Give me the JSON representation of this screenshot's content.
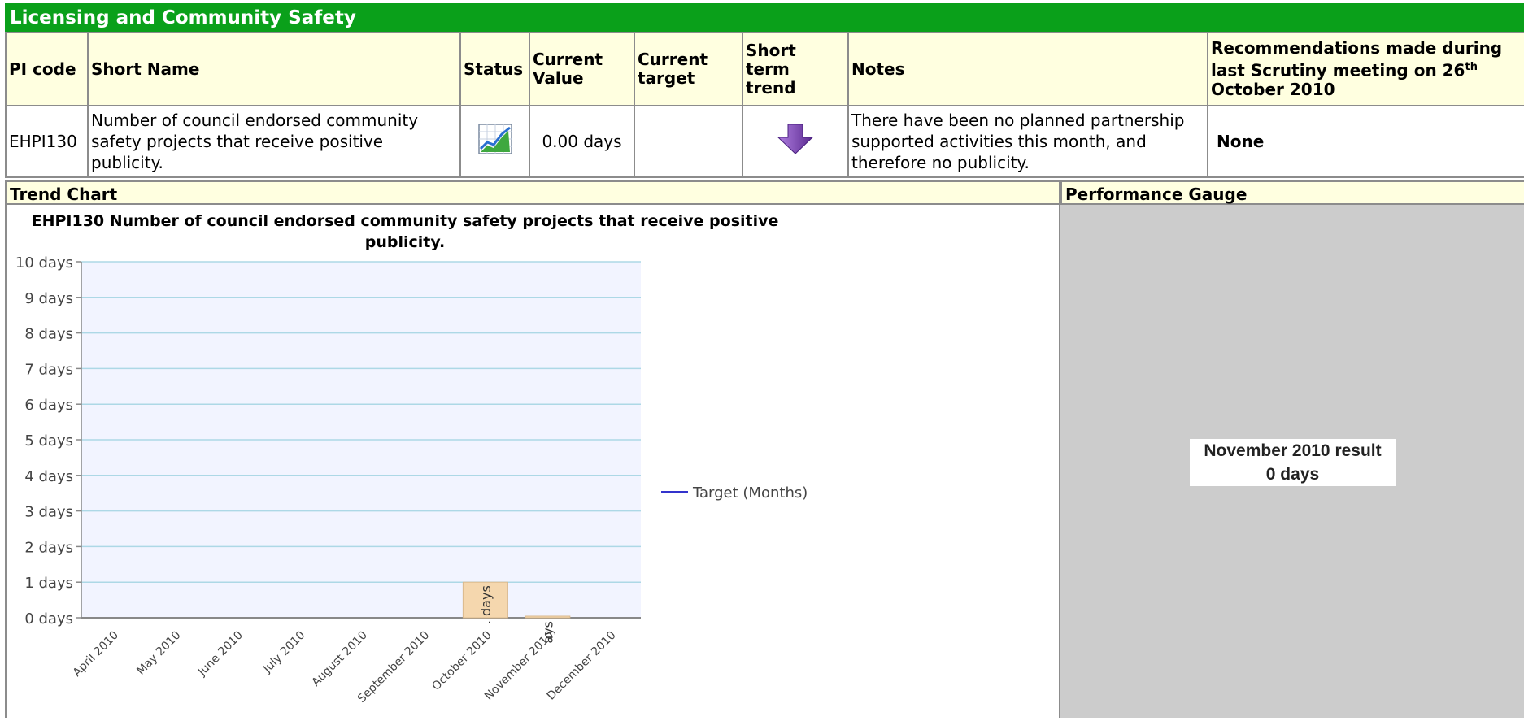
{
  "section_title": "Licensing and Community Safety",
  "table": {
    "headers": {
      "pi_code": "PI code",
      "short_name": "Short Name",
      "status": "Status",
      "current_value": "Current Value",
      "current_target": "Current target",
      "short_term_trend": "Short term trend",
      "notes": "Notes",
      "recommendations_prefix": "Recommendations made during last Scrutiny meeting on 26",
      "recommendations_sup": "th",
      "recommendations_suffix": "October 2010"
    },
    "row": {
      "pi_code": "EHPI130",
      "short_name": "Number of council endorsed community safety projects that receive positive publicity.",
      "status_icon": "data-only-chart-icon",
      "current_value": "0.00 days",
      "current_target": "",
      "trend_icon": "down-arrow-icon",
      "trend_color": "#7b3fb0",
      "notes": "There have been no planned partnership supported activities this month, and therefore no publicity.",
      "recommendations": "None"
    }
  },
  "trend_chart_label": "Trend Chart",
  "performance_gauge_label": "Performance Gauge",
  "gauge": {
    "line1": "November 2010 result",
    "line2": "0 days"
  },
  "chart_data": {
    "type": "bar",
    "title": "EHPI130 Number of council endorsed community safety projects that receive positive publicity.",
    "title_line1": "EHPI130 Number of council endorsed community safety projects that receive positive",
    "title_line2": "publicity.",
    "categories": [
      "April 2010",
      "May 2010",
      "June 2010",
      "July 2010",
      "August 2010",
      "September 2010",
      "October 2010",
      "November 2010",
      "December 2010"
    ],
    "values": [
      null,
      null,
      null,
      null,
      null,
      null,
      1,
      0,
      null
    ],
    "data_labels": [
      "",
      "",
      "",
      "",
      "",
      "",
      ". days",
      "ays",
      ""
    ],
    "y_ticks": [
      "0 days",
      "1 days",
      "2 days",
      "3 days",
      "4 days",
      "5 days",
      "6 days",
      "7 days",
      "8 days",
      "9 days",
      "10 days"
    ],
    "ylim": [
      0,
      10
    ],
    "legend": [
      "Target (Months)"
    ],
    "legend_position": "right",
    "grid": true,
    "colors": {
      "bar": "#f5d7ae",
      "target_line": "#3333cc",
      "grid": "#add8e6",
      "plot_band": "#f2f4ff"
    }
  }
}
